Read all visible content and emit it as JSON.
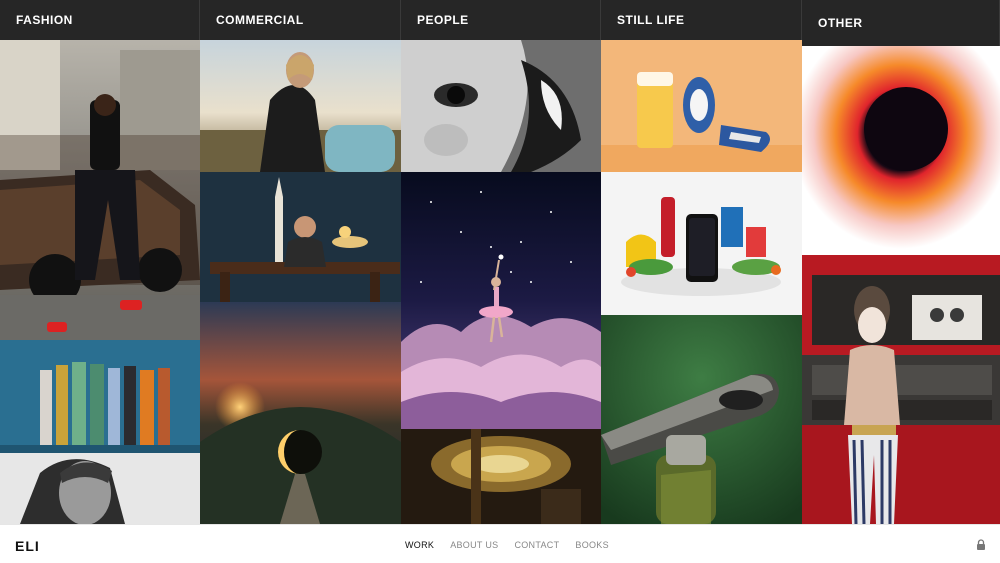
{
  "columns": {
    "fashion": {
      "label": "FASHION"
    },
    "commercial": {
      "label": "COMMERCIAL"
    },
    "people": {
      "label": "PEOPLE"
    },
    "still_life": {
      "label": "STILL LIFE"
    },
    "other": {
      "label": "OTHER"
    }
  },
  "footer": {
    "brand": "ELI",
    "nav": [
      "WORK",
      "ABOUT US",
      "CONTACT",
      "BOOKS"
    ]
  },
  "colors": {
    "header_bg": "#262626",
    "nav_active": "#111111",
    "nav_inactive": "#888888"
  }
}
